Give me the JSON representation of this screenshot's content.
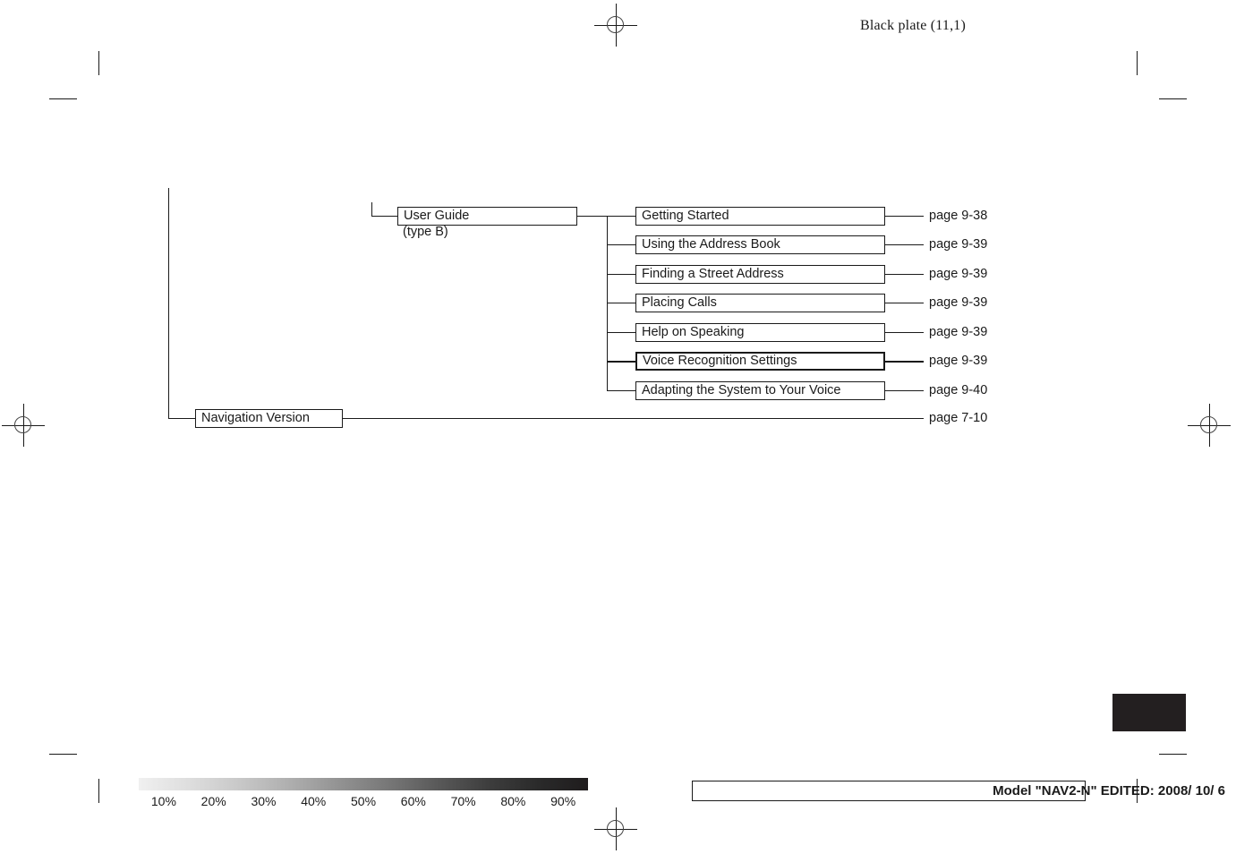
{
  "header": {
    "plate_label": "Black plate (11,1)"
  },
  "diagram": {
    "root_label": "Navigation Version",
    "root_page_ref": "page 7-10",
    "branch": {
      "label": "User Guide",
      "sub_caption": "(type B)"
    },
    "items": [
      {
        "label": "Getting Started",
        "page_ref": "page 9-38",
        "highlighted": false
      },
      {
        "label": "Using the Address Book",
        "page_ref": "page 9-39",
        "highlighted": false
      },
      {
        "label": "Finding a Street Address",
        "page_ref": "page 9-39",
        "highlighted": false
      },
      {
        "label": "Placing Calls",
        "page_ref": "page 9-39",
        "highlighted": false
      },
      {
        "label": "Help on Speaking",
        "page_ref": "page 9-39",
        "highlighted": false
      },
      {
        "label": "Voice Recognition Settings",
        "page_ref": "page 9-39",
        "highlighted": true
      },
      {
        "label": "Adapting the System to Your Voice",
        "page_ref": "page 9-40",
        "highlighted": false
      }
    ]
  },
  "density_strip": {
    "labels": [
      "10%",
      "20%",
      "30%",
      "40%",
      "50%",
      "60%",
      "70%",
      "80%",
      "90%"
    ]
  },
  "footer": {
    "model_text": "Model \"NAV2-N\"  EDITED:  2008/ 10/ 6"
  },
  "colors": {
    "ink": "#1a1a1a",
    "tab": "#231f20",
    "paper": "#ffffff"
  }
}
